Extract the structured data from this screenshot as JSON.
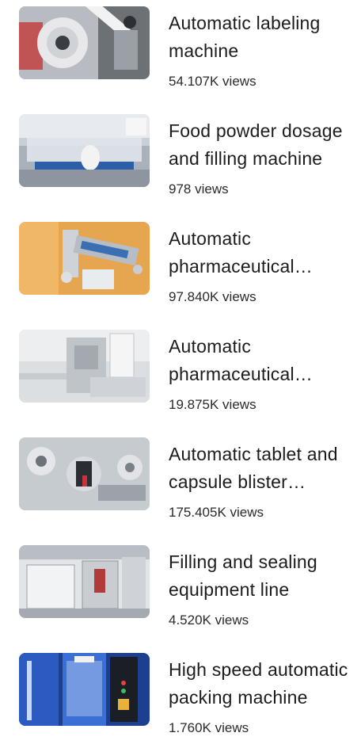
{
  "videos": [
    {
      "title": "Automatic labeling machine",
      "views": "54.107K views",
      "thumb_icon": "labeling-machine-thumbnail"
    },
    {
      "title": "Food powder dosage and filling machine",
      "views": "978 views",
      "thumb_icon": "powder-filling-thumbnail"
    },
    {
      "title": "Automatic pharmaceutical packaging machine",
      "views": "97.840K views",
      "thumb_icon": "pharma-packaging-thumbnail"
    },
    {
      "title": "Automatic pharmaceutical machine",
      "views": "19.875K views",
      "thumb_icon": "pharma-machine-thumbnail"
    },
    {
      "title": "Automatic tablet and capsule blister machine",
      "views": "175.405K views",
      "thumb_icon": "blister-machine-thumbnail"
    },
    {
      "title": "Filling and sealing equipment line",
      "views": "4.520K views",
      "thumb_icon": "filling-sealing-thumbnail"
    },
    {
      "title": "High speed automatic packing machine",
      "views": "1.760K views",
      "thumb_icon": "packing-machine-thumbnail"
    }
  ],
  "colors": {
    "text": "#1c1c1c",
    "subtext": "#2a2a2a",
    "background": "#ffffff"
  }
}
